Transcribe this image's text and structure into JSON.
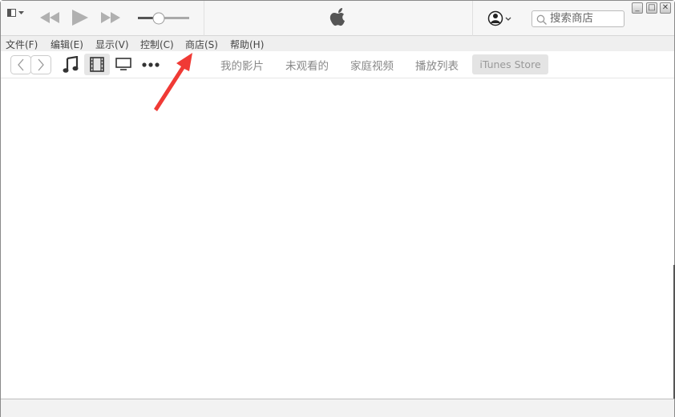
{
  "menu": [
    "文件(F)",
    "编辑(E)",
    "显示(V)",
    "控制(C)",
    "商店(S)",
    "帮助(H)"
  ],
  "tabs": [
    "我的影片",
    "未观看的",
    "家庭视频",
    "播放列表"
  ],
  "store_tab": "iTunes Store",
  "search": {
    "placeholder": "搜索商店"
  },
  "volume": 0.4,
  "colors": {
    "arrow": "#f03a35",
    "accent": "#e4e4e4"
  },
  "icons": [
    "sidebar-toggle-icon",
    "rewind-icon",
    "play-icon",
    "fast-forward-icon",
    "apple-logo-icon",
    "account-icon",
    "search-icon",
    "minimize-icon",
    "maximize-icon",
    "close-icon",
    "back-icon",
    "forward-icon",
    "music-icon",
    "movies-icon",
    "tv-icon",
    "more-icon"
  ]
}
